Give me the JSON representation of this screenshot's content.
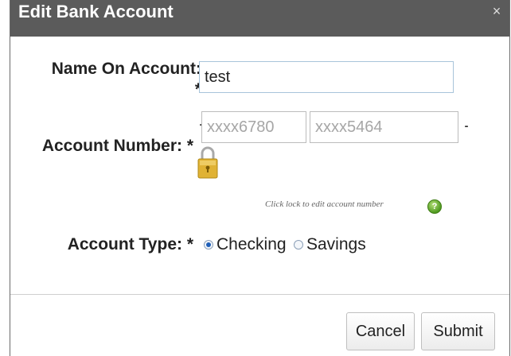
{
  "dialog": {
    "title": "Edit Bank Account",
    "close_symbol": "×"
  },
  "form": {
    "name_label_line1": "Name On Account:",
    "name_label_line2": "*",
    "name_value": "test",
    "number_label": "Account Number: *",
    "account_part1": "xxxx6780",
    "account_part2": "xxxx5464",
    "lock_hint": "Click lock to edit account number",
    "help_icon": "help-icon",
    "lock_icon": "padlock-icon",
    "type_label": "Account Type: *",
    "type_options": [
      {
        "label": "Checking",
        "selected": true
      },
      {
        "label": "Savings",
        "selected": false
      }
    ]
  },
  "buttons": {
    "cancel": "Cancel",
    "submit": "Submit"
  },
  "colors": {
    "titlebar": "#5b5b5b",
    "help": "#4f9a1f",
    "lock": "#e0b234"
  }
}
